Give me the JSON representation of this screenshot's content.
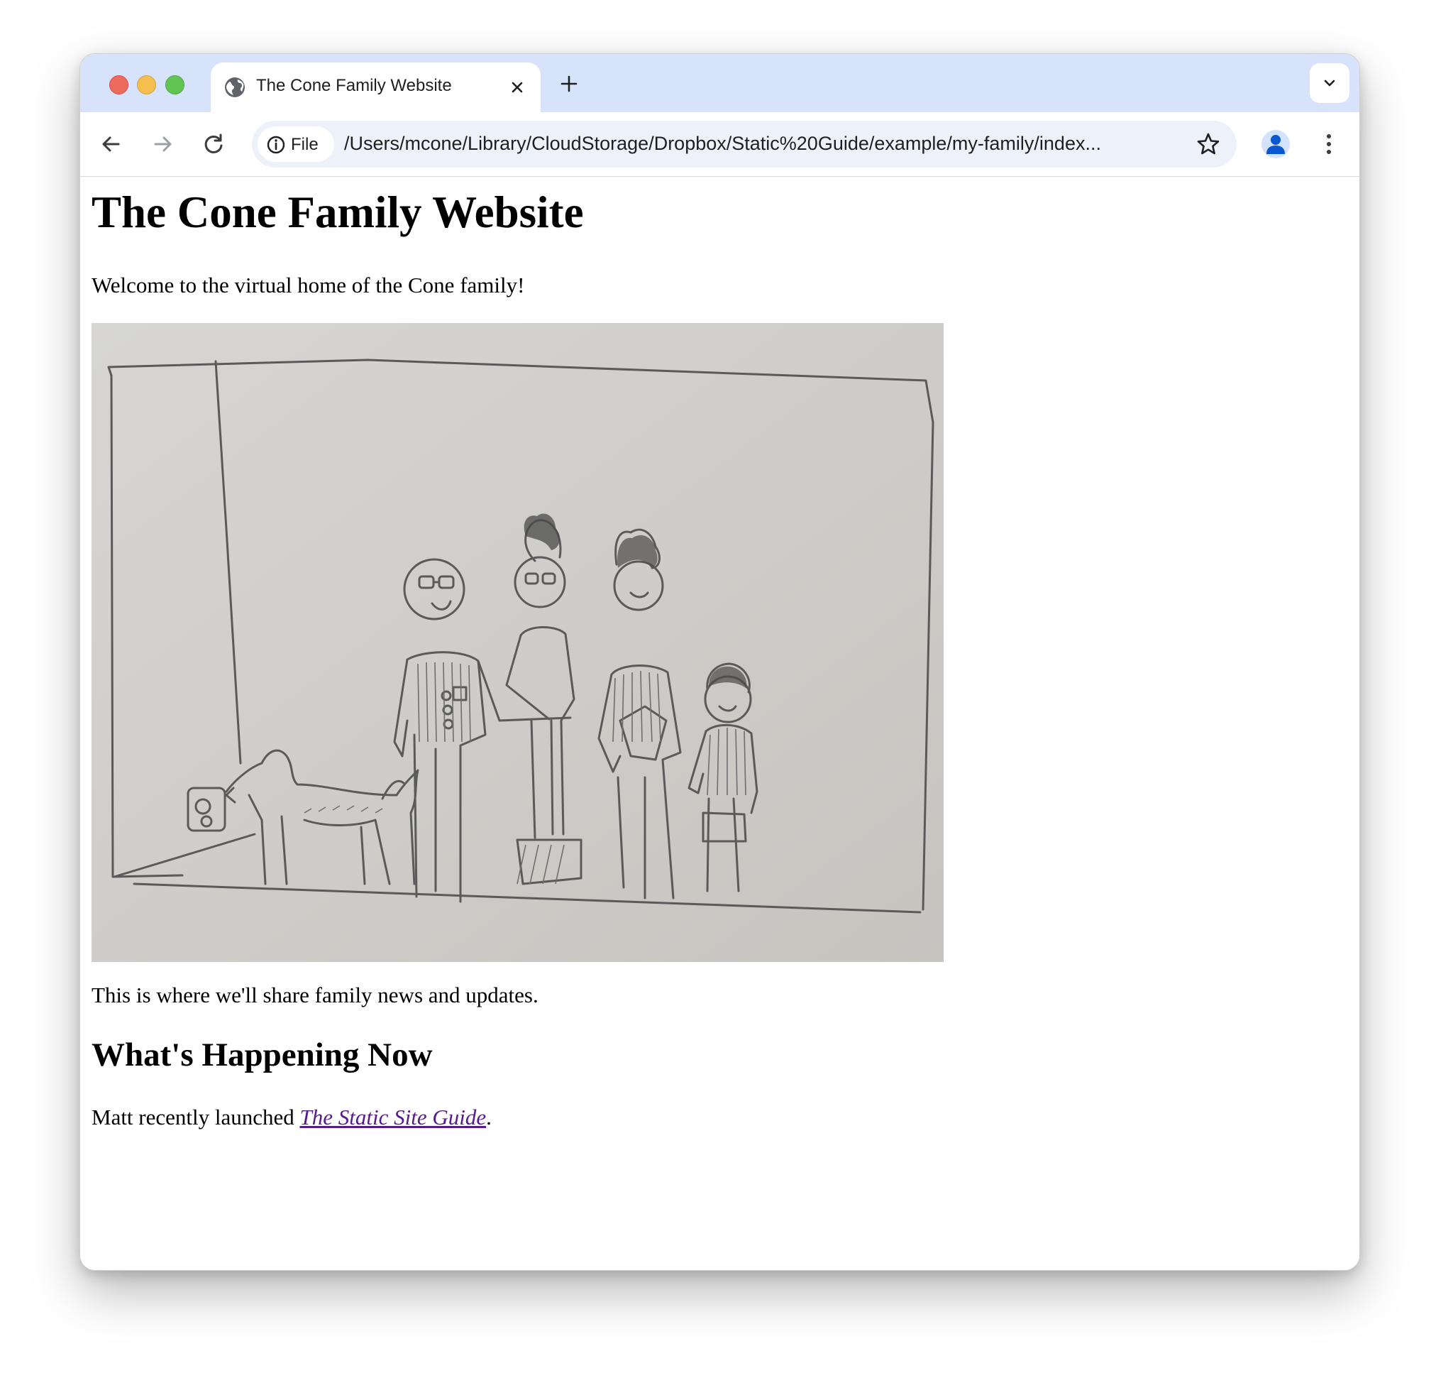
{
  "browser": {
    "tab_title": "The Cone Family Website",
    "site_chip_label": "File",
    "url": "/Users/mcone/Library/CloudStorage/Dropbox/Static%20Guide/example/my-family/index...",
    "icons": [
      "globe-icon",
      "close-icon",
      "plus-icon",
      "chevron-down-icon",
      "back-arrow-icon",
      "forward-arrow-icon",
      "reload-icon",
      "info-icon",
      "star-icon",
      "profile-icon",
      "kebab-menu-icon"
    ]
  },
  "page": {
    "title": "The Cone Family Website",
    "welcome": "Welcome to the virtual home of the Cone family!",
    "news": "This is where we'll share family news and updates.",
    "section_heading": "What's Happening Now",
    "matt_prefix": "Matt recently launched ",
    "matt_link": "The Static Site Guide",
    "matt_suffix": "."
  },
  "colors": {
    "tabbar": "#d7e3fb",
    "omnibox": "#edf2fa",
    "visited_link": "#551a8b"
  }
}
